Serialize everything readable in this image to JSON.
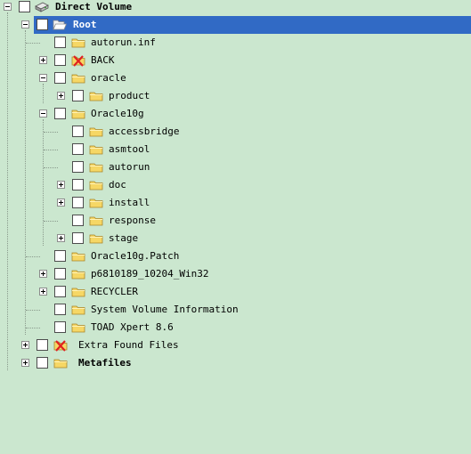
{
  "window": {
    "background": "#cbe7cf",
    "selection_color": "#316ac5"
  },
  "tree": {
    "nodes": [
      {
        "label": "Direct Volume",
        "icon": "drive-icon",
        "expander": "expanded"
      },
      {
        "label": "Root",
        "icon": "folder-open-icon",
        "expander": "expanded",
        "selected": true
      },
      {
        "label": "autorun.inf",
        "icon": "folder-icon",
        "expander": "none"
      },
      {
        "label": "BACK",
        "icon": "deleted-icon",
        "expander": "collapsed"
      },
      {
        "label": "oracle",
        "icon": "folder-icon",
        "expander": "expanded"
      },
      {
        "label": "product",
        "icon": "folder-icon",
        "expander": "collapsed"
      },
      {
        "label": "Oracle10g",
        "icon": "folder-icon",
        "expander": "expanded"
      },
      {
        "label": "accessbridge",
        "icon": "folder-icon",
        "expander": "none"
      },
      {
        "label": "asmtool",
        "icon": "folder-icon",
        "expander": "none"
      },
      {
        "label": "autorun",
        "icon": "folder-icon",
        "expander": "none"
      },
      {
        "label": "doc",
        "icon": "folder-icon",
        "expander": "collapsed"
      },
      {
        "label": "install",
        "icon": "folder-icon",
        "expander": "collapsed"
      },
      {
        "label": "response",
        "icon": "folder-icon",
        "expander": "none"
      },
      {
        "label": "stage",
        "icon": "folder-icon",
        "expander": "collapsed"
      },
      {
        "label": "Oracle10g.Patch",
        "icon": "folder-icon",
        "expander": "none"
      },
      {
        "label": "p6810189_10204_Win32",
        "icon": "folder-icon",
        "expander": "collapsed"
      },
      {
        "label": "RECYCLER",
        "icon": "folder-icon",
        "expander": "collapsed"
      },
      {
        "label": "System Volume Information",
        "icon": "folder-icon",
        "expander": "none"
      },
      {
        "label": "TOAD Xpert 8.6",
        "icon": "folder-icon",
        "expander": "none"
      },
      {
        "label": "Extra Found Files",
        "icon": "deleted-icon",
        "expander": "collapsed"
      },
      {
        "label": "Metafiles",
        "icon": "folder-icon",
        "expander": "collapsed"
      }
    ]
  }
}
